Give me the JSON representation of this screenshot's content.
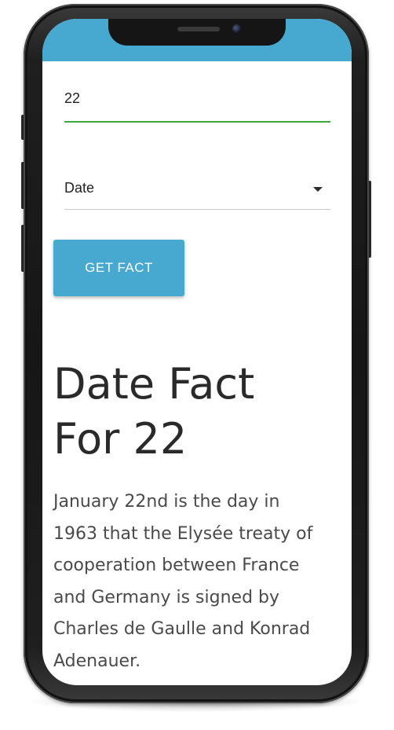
{
  "form": {
    "number_value": "22",
    "type_selected": "Date",
    "button_label": "GET FACT"
  },
  "result": {
    "heading_lines": [
      "Date Fact",
      "For 22"
    ],
    "text_lines": [
      "January 22nd is the day in",
      "1963 that the Elysée treaty of",
      "cooperation between France",
      "and Germany is signed by",
      "Charles de Gaulle and Konrad",
      "Adenauer."
    ]
  },
  "colors": {
    "app_bar": "#47a9d0",
    "button": "#47a9d0",
    "input_focus_underline": "#3ea63e"
  },
  "icons": {
    "select_caret": "caret-down-icon"
  }
}
